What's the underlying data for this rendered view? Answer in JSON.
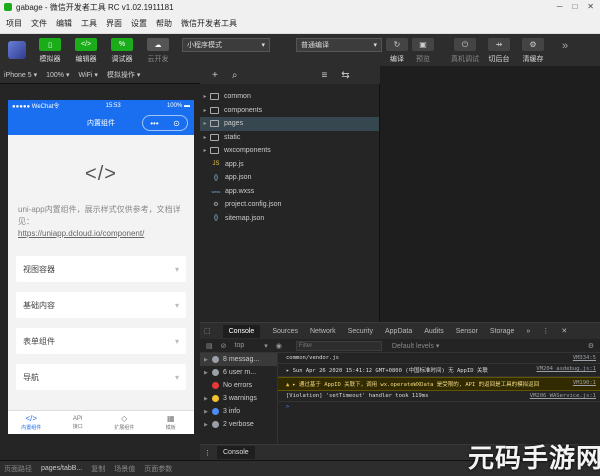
{
  "titlebar": {
    "title": "gabage - 微信开发者工具 RC v1.02.1911181",
    "min": "─",
    "max": "□",
    "close": "✕"
  },
  "menu": [
    "项目",
    "文件",
    "编辑",
    "工具",
    "界面",
    "设置",
    "帮助",
    "微信开发者工具"
  ],
  "toolbar": {
    "simulator_label": "模拟器",
    "editor_label": "编辑器",
    "debugger_label": "调试器",
    "cloud_label": "云开发",
    "mode_select": "小程序模式",
    "compile_select": "普通编译",
    "compile_label": "编译",
    "preview_label": "预览",
    "realdebug_label": "真机调试",
    "backend_label": "切后台",
    "cache_label": "清缓存",
    "editor_icon": "</>",
    "debugger_icon": "%",
    "more": "»"
  },
  "simbar": {
    "device": "iPhone 5 ▾",
    "zoom": "100% ▾",
    "network": "WiFi ▾",
    "ops": "模拟操作 ▾"
  },
  "treebar": {
    "add": "+",
    "search": "⌕",
    "more": "≡",
    "tree_toggle": "⇆"
  },
  "phone": {
    "carrier": "●●●●● WeChat令",
    "time": "15:53",
    "battery": "100% ▬",
    "nav_title": "内置组件",
    "capsule_more": "•••",
    "capsule_close": "⊙",
    "code_icon": "</>",
    "description": "uni-app内置组件，展示样式仅供参考，文档详见：",
    "link": "https://uniapp.dcloud.io/component/",
    "cards": [
      "视图容器",
      "基础内容",
      "表单组件",
      "导航"
    ],
    "tabs": [
      {
        "icon": "</>",
        "label": "内置组件"
      },
      {
        "icon": "API",
        "label": "接口"
      },
      {
        "icon": "◇",
        "label": "扩展组件"
      },
      {
        "icon": "▦",
        "label": "模板"
      }
    ]
  },
  "tree": [
    {
      "name": "common",
      "type": "folder"
    },
    {
      "name": "components",
      "type": "folder"
    },
    {
      "name": "pages",
      "type": "folder",
      "selected": true
    },
    {
      "name": "static",
      "type": "folder"
    },
    {
      "name": "wxcomponents",
      "type": "folder"
    },
    {
      "name": "app.js",
      "type": "js",
      "icon": "JS"
    },
    {
      "name": "app.json",
      "type": "json",
      "icon": "{}"
    },
    {
      "name": "app.wxss",
      "type": "wxss",
      "icon": "wxss"
    },
    {
      "name": "project.config.json",
      "type": "cfg",
      "icon": "⚙"
    },
    {
      "name": "sitemap.json",
      "type": "json",
      "icon": "{}"
    }
  ],
  "devtools": {
    "tabs": [
      "Console",
      "Sources",
      "Network",
      "Security",
      "AppData",
      "Audits",
      "Sensor",
      "Storage",
      "»"
    ],
    "kebab": "⋮",
    "close_icon": "✕",
    "context": "top",
    "filter_placeholder": "Filter",
    "levels": "Default levels ▾",
    "settings_icon": "⚙",
    "sidebar": [
      {
        "label": "8 messag...",
        "icon": "list",
        "color": "#9aa0a6"
      },
      {
        "label": "6 user m...",
        "icon": "user",
        "color": "#9aa0a6"
      },
      {
        "label": "No errors",
        "icon": "error",
        "color": "#e53935"
      },
      {
        "label": "3 warnings",
        "icon": "warning",
        "color": "#f2c12e"
      },
      {
        "label": "3 info",
        "icon": "info",
        "color": "#4e8cf5"
      },
      {
        "label": "2 verbose",
        "icon": "verbose",
        "color": "#9aa0a6"
      }
    ],
    "logs": [
      {
        "text": "common/vendor.js",
        "src": "VM334:5",
        "level": "plain"
      },
      {
        "text": "▸ Sun Apr 26 2020 15:41:12 GMT+0800 (中国标准时间) 无 AppID 关联",
        "src": "VM204 asdebug.js:1",
        "level": "plain"
      },
      {
        "text": "▸ 通过基于 AppID 关联下，调用 wx.operateWXData 是受限的, API 的返回是工具的模拟返回",
        "src": "VM190:1",
        "level": "warn"
      },
      {
        "text": "[Violation] 'setTimeout' handler took 119ms",
        "src": "VM206 WAService.js:1",
        "level": "plain"
      }
    ],
    "prompt": ">",
    "console_tab": "Console"
  },
  "statusbar": {
    "path": "页面路径",
    "page": "pages/tabB...",
    "copy": "复制",
    "params": "场景值",
    "page_params": "页面参数"
  },
  "watermark": "元码手游网",
  "colors": {
    "accent_green": "#1aad19",
    "phone_blue": "#1a6ff0",
    "warn_bg": "#332b00"
  }
}
